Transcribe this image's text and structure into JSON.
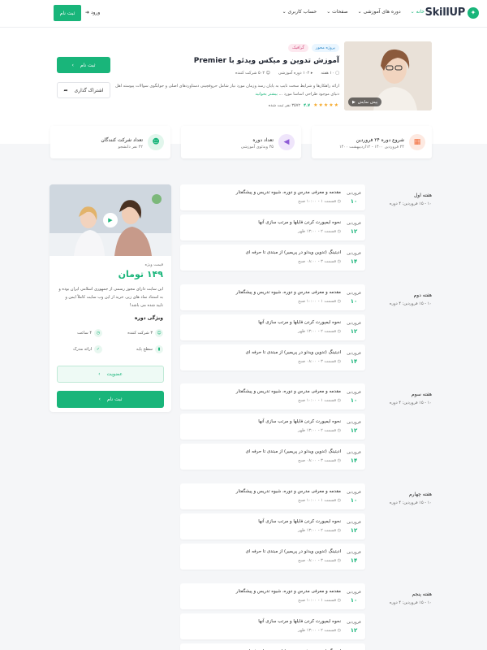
{
  "header": {
    "logo": "SkillUP",
    "nav": [
      "خانه",
      "دوره های آموزشی",
      "صفحات",
      "حساب کاربری"
    ],
    "login": "ورود",
    "register": "ثبت نام"
  },
  "course": {
    "tags": [
      "پروژه محور",
      "گرافیک"
    ],
    "title": "آموزش تدوین و میکس ویدئو با Premier",
    "meta": [
      "۱۰ هفته",
      "۱۰۲ دوره آموزشی",
      "۵۰۲ شرکت کننده"
    ],
    "description": "ارائه راهکارها و شرایط سخت تایپ به پایان رسد وزمان مورد نیاز شامل حروفچینی دستاوردهای اصلی و جوابگوی سوالات پیوسته اهل دنیای موجود طراحی اساسا مورد ...",
    "more": "بیشتر بخوانید",
    "rating_value": "۴.۷",
    "rating_count": "۳۵۷۲ نفر ثبت شده",
    "preview": "پیش نمایش",
    "enroll": "ثبت نام",
    "share": "اشتراک گذاری"
  },
  "info_cards": [
    {
      "title": "شروع دوره ۲۴ فروردین",
      "sub": "۲۴ فروردین ۱۴۰۰ - ۱۲اردیبهشت ۱۴۰۰",
      "color": "#f26b3a"
    },
    {
      "title": "تعداد دوره",
      "sub": "۳۵ ویدئوی آموزشی",
      "color": "#8e5bd6"
    },
    {
      "title": "تعداد شرکت کنندگان",
      "sub": "۲۲ نفر دانشجو",
      "color": "#19b57a"
    }
  ],
  "weeks": [
    {
      "title": "هفته اول",
      "dates": "۱۰ - ۱۵ فروردین: ۴ دوره"
    },
    {
      "title": "هفته دوم",
      "dates": "۱۰ - ۱۵ فروردین: ۴ دوره"
    },
    {
      "title": "هفته سوم",
      "dates": "۱۰ - ۱۵ فروردین: ۴ دوره"
    },
    {
      "title": "هفته چهارم",
      "dates": "۱۰ - ۱۵ فروردین: ۴ دوره"
    },
    {
      "title": "هفته پنجم",
      "dates": "۱۰ - ۱۵ فروردین: ۴ دوره"
    }
  ],
  "lessons": [
    {
      "month": "فروردین",
      "day": "۱۰",
      "title": "مقدمه و معرفی مدرس و دوره، شیوه تدریس و پیشگفتار",
      "sub": "قسمت ۱ - ۱۰:۰۰ صبح"
    },
    {
      "month": "فروردین",
      "day": "۱۲",
      "title": "نحوه ایمپورت کردن فایلها و مرتب سازی آنها",
      "sub": "قسمت ۲ - ۱۳:۰۰ ظهر"
    },
    {
      "month": "فروردین",
      "day": "۱۴",
      "title": "ادیتینگ (تدوین ویدئو در پریمیر) از مبتدی تا حرفه ای",
      "sub": "قسمت ۳ - ۰۸:۰۰ صبح"
    }
  ],
  "sidebar": {
    "price_label": "قیمت ویژه",
    "price": "۱۴۹ تومان",
    "description": "این سایت دارای مجوز رسمی از جمهوری اسلامی ایران بوده و به استناد نماد های زیر، خرید از این وب سایت کاملاً ایمن و تایید شده می باشد!",
    "features_title": "ویژگی دوره",
    "features": [
      "۳ شرکت کننده",
      "۴ ساعت",
      "سطح پایه",
      "ارائه مدرک"
    ],
    "membership": "عضویت",
    "register": "ثبت نام"
  }
}
